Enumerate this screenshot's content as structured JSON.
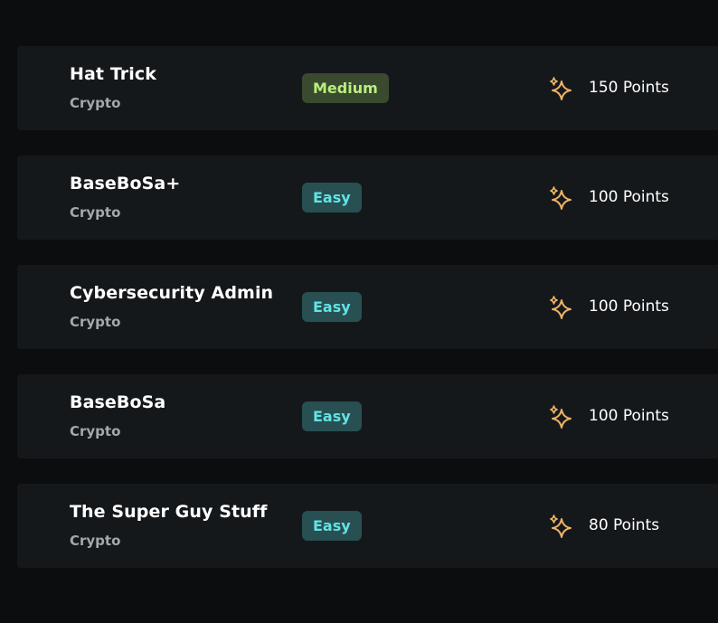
{
  "challenges": [
    {
      "title": "Hat Trick",
      "category": "Crypto",
      "difficulty": "Medium",
      "points": "150 Points"
    },
    {
      "title": "BaseBoSa+",
      "category": "Crypto",
      "difficulty": "Easy",
      "points": "100 Points"
    },
    {
      "title": "Cybersecurity Admin",
      "category": "Crypto",
      "difficulty": "Easy",
      "points": "100 Points"
    },
    {
      "title": "BaseBoSa",
      "category": "Crypto",
      "difficulty": "Easy",
      "points": "100 Points"
    },
    {
      "title": "The Super Guy Stuff",
      "category": "Crypto",
      "difficulty": "Easy",
      "points": "80 Points"
    }
  ],
  "icons": {
    "points": "sparkles-icon"
  },
  "colors": {
    "background": "#0c0d0f",
    "card": "#15181b",
    "easy_badge_bg": "#284f52",
    "easy_badge_text": "#62e3e4",
    "medium_badge_bg": "#3a4a2f",
    "medium_badge_text": "#b8ef7e",
    "sparkle": "#f0b465"
  }
}
